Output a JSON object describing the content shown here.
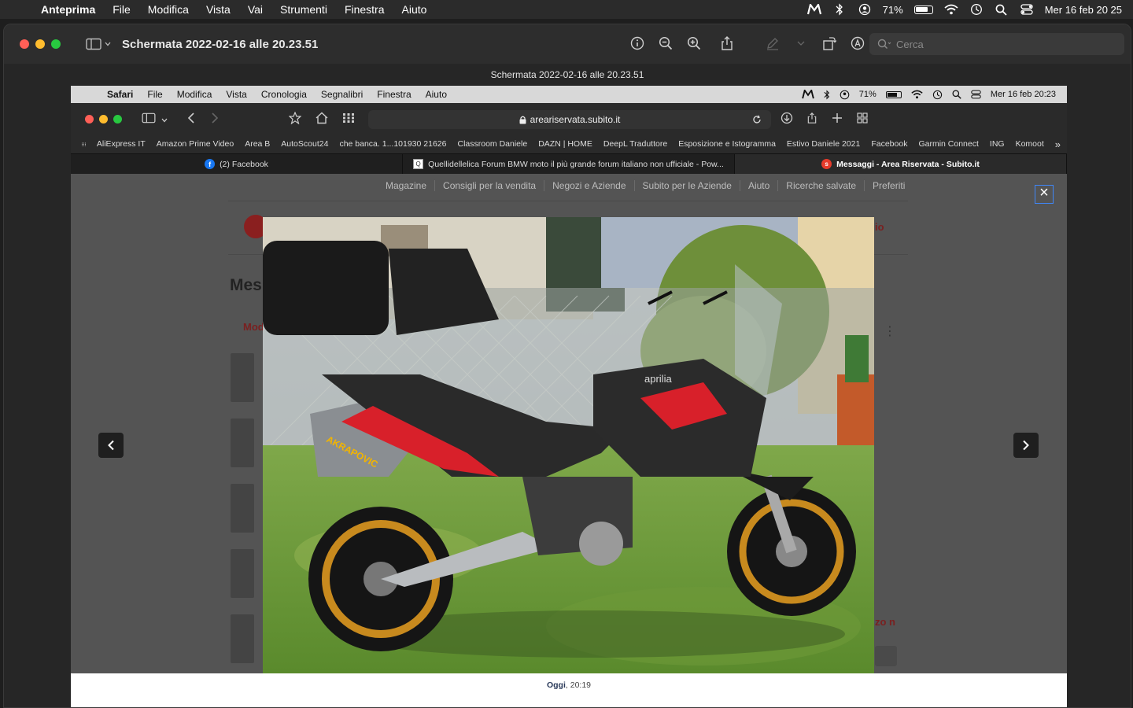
{
  "menubar": {
    "app": "Anteprima",
    "items": [
      "File",
      "Modifica",
      "Vista",
      "Vai",
      "Strumenti",
      "Finestra",
      "Aiuto"
    ],
    "battery": "71%",
    "clock": "Mer 16 feb  20 25"
  },
  "preview": {
    "title": "Schermata 2022-02-16 alle 20.23.51",
    "subtitle": "Schermata 2022-02-16 alle 20.23.51",
    "search_placeholder": "Cerca"
  },
  "inner_menubar": {
    "app": "Safari",
    "items": [
      "File",
      "Modifica",
      "Vista",
      "Cronologia",
      "Segnalibri",
      "Finestra",
      "Aiuto"
    ],
    "battery": "71%",
    "clock": "Mer 16 feb  20:23"
  },
  "safari": {
    "url": "areariservata.subito.it",
    "bookmarks": [
      "AliExpress IT",
      "Amazon Prime Video",
      "Area B",
      "AutoScout24",
      "che banca. 1...101930 21626",
      "Classroom Daniele",
      "DAZN | HOME",
      "DeepL Traduttore",
      "Esposizione e Istogramma",
      "Estivo Daniele 2021",
      "Facebook",
      "Garmin Connect",
      "ING",
      "Komoot"
    ],
    "tabs": [
      {
        "label": "(2) Facebook"
      },
      {
        "label": "Quellidellelica Forum BMW moto il più grande forum italiano non ufficiale - Pow..."
      },
      {
        "label": "Messaggi - Area Riservata - Subito.it"
      }
    ]
  },
  "site": {
    "nav": [
      "Magazine",
      "Consigli per la vendita",
      "Negozi e Aziende",
      "Subito per le Aziende",
      "Aiuto",
      "Ricerche salvate",
      "Preferiti"
    ],
    "ghost_title": "Mes",
    "ghost_tab": "Mod",
    "ghost_side": "io",
    "ghost_zo": "zo n"
  },
  "lightbox": {
    "caption_day": "Oggi",
    "caption_time": ", 20:19",
    "photo_brand": "aprilia",
    "exhaust_text": "AKRAPOVIC"
  },
  "colors": {
    "accent_blue": "#3f86f7",
    "red": "#ff5f57",
    "yellow": "#febc2e",
    "green": "#28c840"
  }
}
